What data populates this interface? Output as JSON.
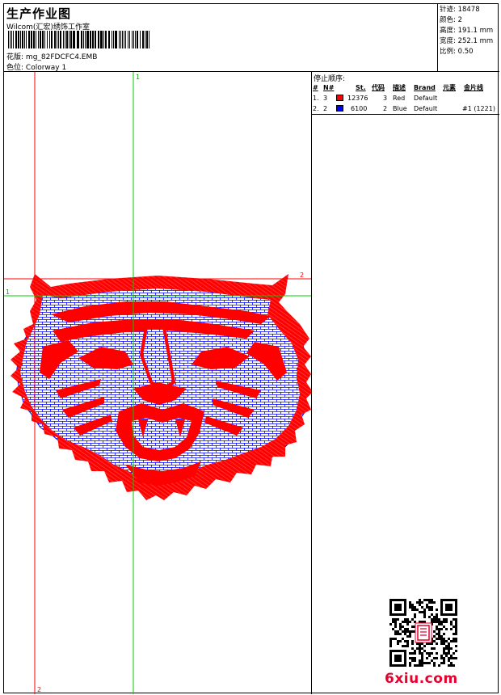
{
  "header": {
    "title": "生产作业图",
    "studio": "Wilcom(汇宏)绣饰工作室",
    "design_label": "花版:",
    "design_value": "mg_82FDCFC4.EMB",
    "colorway_label": "色位:",
    "colorway_value": "Colorway 1"
  },
  "stats": [
    {
      "label": "针迹:",
      "value": "18478"
    },
    {
      "label": "颜色:",
      "value": "2"
    },
    {
      "label": "高度:",
      "value": "191.1 mm"
    },
    {
      "label": "宽度:",
      "value": "252.1 mm"
    },
    {
      "label": "比例:",
      "value": "0.50"
    }
  ],
  "stop_sequence": {
    "title": "停止顺序:",
    "headers": {
      "index": "#",
      "needle": "N#",
      "stitches": "St.",
      "code": "代码",
      "desc": "描述",
      "brand": "Brand",
      "element": "元素",
      "sequin": "金片线"
    },
    "rows": [
      {
        "index": "1.",
        "needle": "3",
        "color": "#ff0000",
        "stitches": "12376",
        "code": "3",
        "desc": "Red",
        "brand": "Default",
        "sequin": ""
      },
      {
        "index": "2.",
        "needle": "2",
        "color": "#0000ff",
        "stitches": "6100",
        "code": "2",
        "desc": "Blue",
        "brand": "Default",
        "sequin": "#1 (1221)"
      }
    ]
  },
  "guides": {
    "green_v": "1",
    "red_h": "2",
    "green_h": "1",
    "red_v": "2"
  },
  "colors": {
    "red": "#ff0000",
    "blue": "#0000ff",
    "green": "#00cc00"
  },
  "watermark": "6xiu.com"
}
